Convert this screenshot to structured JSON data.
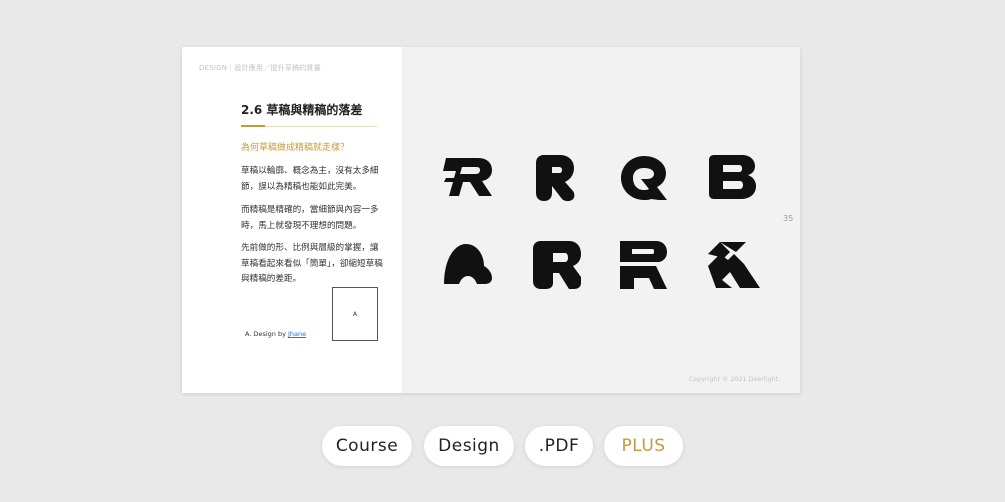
{
  "slide": {
    "breadcrumb": "DESIGN｜設計應用／提升草稿的質量",
    "title": "2.6 草稿與精稿的落差",
    "question": "為何草稿做成精稿就走樣？",
    "paragraphs": [
      "草稿以輪廓、概念為主，沒有太多細節，誤以為精稿也能如此完美。",
      "而精稿是精確的，當細節與內容一多時，馬上就發現不理想的問題。",
      "先前做的形、比例與層級的掌握，讓草稿看起來看似「簡單」，卻縮短草稿與精稿的差距。"
    ],
    "caption_prefix": "A. Design by ",
    "caption_author": "Jhane",
    "thumb_label": "A",
    "page_number": "35",
    "copyright": "Copyright © 2021 Deerlight.",
    "accent_color": "#c89a3c",
    "logos": [
      "r-logo-speed",
      "r-logo-rounded",
      "r-logo-circle",
      "b-logo-block",
      "a-logo-blob",
      "r-logo-block",
      "r-logo-stencil",
      "k-logo-geometric"
    ]
  },
  "pills": [
    {
      "label": "Course"
    },
    {
      "label": "Design"
    },
    {
      "label": ".PDF"
    },
    {
      "label": "PLUS"
    }
  ]
}
